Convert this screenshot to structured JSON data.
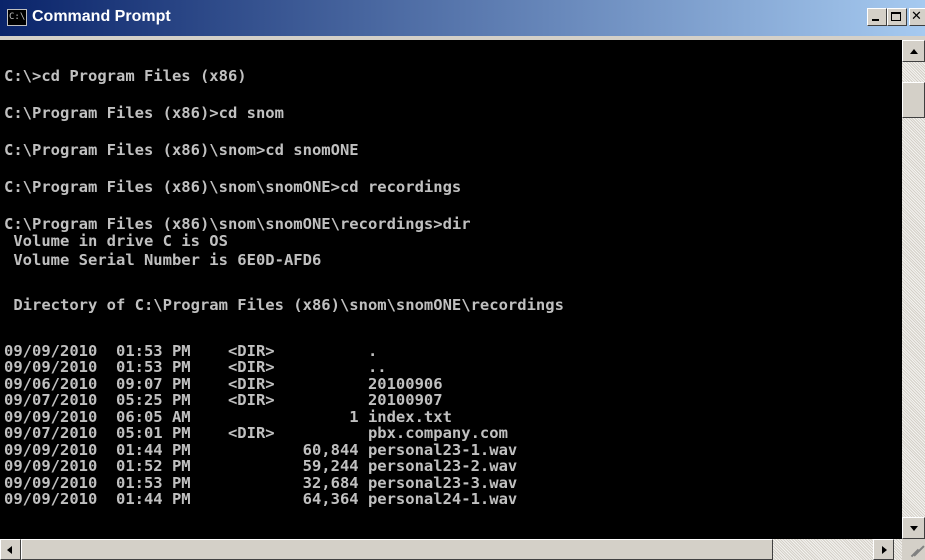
{
  "window": {
    "title": "Command Prompt",
    "icon_label": "C:\\."
  },
  "console": {
    "lines": [
      "C:\\>cd Program Files (x86)",
      "C:\\Program Files (x86)>cd snom",
      "C:\\Program Files (x86)\\snom>cd snomONE",
      "C:\\Program Files (x86)\\snom\\snomONE>cd recordings",
      "C:\\Program Files (x86)\\snom\\snomONE\\recordings>dir",
      " Volume in drive C is OS",
      " Volume Serial Number is 6E0D-AFD6",
      " Directory of C:\\Program Files (x86)\\snom\\snomONE\\recordings"
    ],
    "listing": [
      "09/09/2010  01:53 PM    <DIR>          .",
      "09/09/2010  01:53 PM    <DIR>          ..",
      "09/06/2010  09:07 PM    <DIR>          20100906",
      "09/07/2010  05:25 PM    <DIR>          20100907",
      "09/09/2010  06:05 AM                 1 index.txt",
      "09/07/2010  05:01 PM    <DIR>          pbx.company.com",
      "09/09/2010  01:44 PM            60,844 personal23-1.wav",
      "09/09/2010  01:52 PM            59,244 personal23-2.wav",
      "09/09/2010  01:53 PM            32,684 personal23-3.wav",
      "09/09/2010  01:44 PM            64,364 personal24-1.wav"
    ]
  },
  "icons": {
    "window": "cmd-window-icon",
    "minimize": "minimize-icon",
    "maximize": "maximize-icon",
    "close": "close-icon",
    "scroll_up": "arrow-up-icon",
    "scroll_down": "arrow-down-icon",
    "scroll_left": "arrow-left-icon",
    "scroll_right": "arrow-right-icon",
    "resize": "resize-grip-icon"
  },
  "colors": {
    "console_bg": "#000000",
    "console_text": "#c0c0c0",
    "title_gradient_start": "#0a246a",
    "title_gradient_end": "#a6caf0"
  }
}
